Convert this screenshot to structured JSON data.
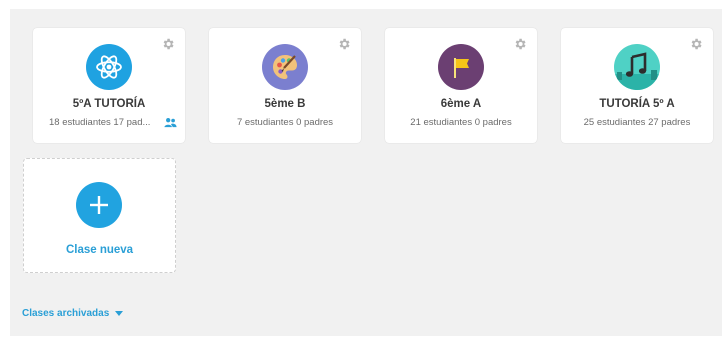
{
  "classes": [
    {
      "name": "5ºA TUTORÍA",
      "stats": "18 estudiantes 17 pad...",
      "icon": "atom-icon",
      "icon_color": "#1fa2e1",
      "has_parents_icon": true
    },
    {
      "name": "5ème B",
      "stats": "7 estudiantes 0 padres",
      "icon": "palette-icon",
      "icon_color": "#7b7fcf"
    },
    {
      "name": "6ème A",
      "stats": "21 estudiantes 0 padres",
      "icon": "flag-icon",
      "icon_color": "#6b3f72"
    },
    {
      "name": "TUTORÍA 5º A",
      "stats": "25 estudiantes 27 padres",
      "icon": "music-note-icon",
      "icon_color": "#4fd1c5"
    }
  ],
  "new_class": {
    "label": "Clase nueva",
    "icon": "plus-icon"
  },
  "archived": {
    "label": "Clases archivadas",
    "icon": "caret-down-icon"
  },
  "colors": {
    "accent": "#21a3e0",
    "background": "#f1f1f1",
    "card": "#ffffff"
  }
}
